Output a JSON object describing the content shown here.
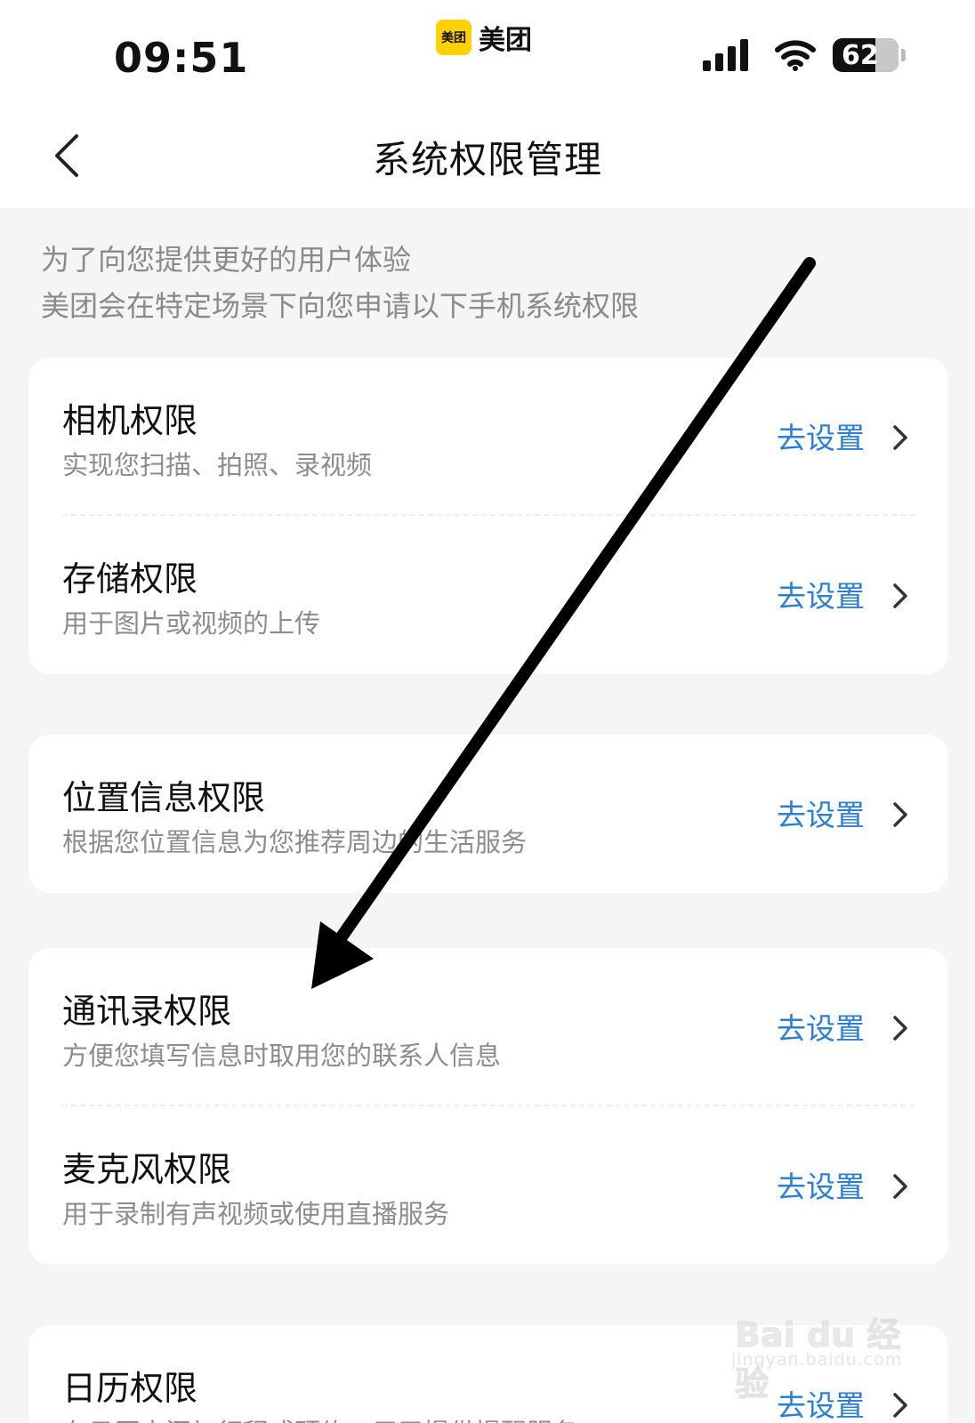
{
  "status_bar": {
    "time": "09:51",
    "app_logo_text": "美团",
    "app_name": "美团",
    "battery": "62"
  },
  "header": {
    "title": "系统权限管理"
  },
  "intro": {
    "line1": "为了向您提供更好的用户体验",
    "line2": "美团会在特定场景下向您申请以下手机系统权限"
  },
  "permissions": [
    {
      "title": "相机权限",
      "desc": "实现您扫描、拍照、录视频",
      "action": "去设置"
    },
    {
      "title": "存储权限",
      "desc": "用于图片或视频的上传",
      "action": "去设置"
    },
    {
      "title": "位置信息权限",
      "desc": "根据您位置信息为您推荐周边的生活服务",
      "action": "去设置"
    },
    {
      "title": "通讯录权限",
      "desc": "方便您填写信息时取用您的联系人信息",
      "action": "去设置"
    },
    {
      "title": "麦克风权限",
      "desc": "用于录制有声视频或使用直播服务",
      "action": "去设置"
    },
    {
      "title": "日历权限",
      "desc": "在日历中添加行程或预约，用于提供提醒服务",
      "action": "去设置"
    }
  ],
  "watermark": {
    "brand": "Bai du 经验",
    "url": "jingyan.baidu.com"
  },
  "colors": {
    "accent": "#2e7fd2",
    "brand_yellow": "#ffd100",
    "background": "#f5f5f5"
  },
  "icons": [
    "back-chevron-icon",
    "signal-icon",
    "wifi-icon",
    "battery-icon",
    "chevron-right-icon",
    "annotation-arrow"
  ]
}
